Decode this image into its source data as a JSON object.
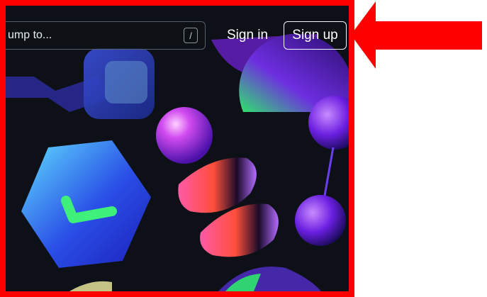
{
  "header": {
    "search_placeholder": "ump to...",
    "search_shortcut": "/",
    "sign_in_label": "Sign in",
    "sign_up_label": "Sign up"
  },
  "annotation": {
    "highlight_color": "#ff0000",
    "arrow_target": "sign-up-button"
  },
  "icons": {
    "hero_shapes": "abstract-3d-shapes",
    "arrow": "arrow-left-icon"
  },
  "colors": {
    "background": "#0d1117",
    "button_border": "#f0f6fc",
    "accent_purple": "#8a2be2",
    "accent_green": "#2ee56b"
  }
}
